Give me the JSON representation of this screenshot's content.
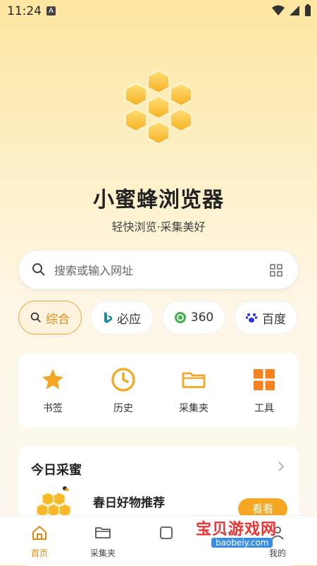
{
  "status": {
    "time": "11:24",
    "indicator": "A"
  },
  "app": {
    "title": "小蜜蜂浏览器",
    "subtitle": "轻快浏览·采集美好"
  },
  "search": {
    "placeholder": "搜索或输入网址"
  },
  "engines": [
    {
      "label": "综合",
      "icon": "search-icon",
      "active": true
    },
    {
      "label": "必应",
      "icon": "bing-icon"
    },
    {
      "label": "360",
      "icon": "360-icon"
    },
    {
      "label": "百度",
      "icon": "baidu-icon"
    }
  ],
  "quick": [
    {
      "label": "书签",
      "icon": "star-icon"
    },
    {
      "label": "历史",
      "icon": "clock-icon"
    },
    {
      "label": "采集夹",
      "icon": "folder-icon"
    },
    {
      "label": "工具",
      "icon": "grid-icon"
    }
  ],
  "today": {
    "title": "今日采蜜",
    "item_title": "春日好物推荐",
    "button": "看看"
  },
  "tabs": [
    {
      "label": "首页",
      "icon": "home-icon",
      "active": true
    },
    {
      "label": "采集夹",
      "icon": "folder-icon"
    },
    {
      "label": "",
      "icon": "tabs-icon"
    },
    {
      "label": "",
      "icon": "more-icon"
    },
    {
      "label": "我的",
      "icon": "profile-icon"
    }
  ],
  "watermark": {
    "text": "宝贝游戏网",
    "url": "baobeiy.com"
  },
  "colors": {
    "accent": "#f5a623",
    "accent_dark": "#e08a16"
  }
}
